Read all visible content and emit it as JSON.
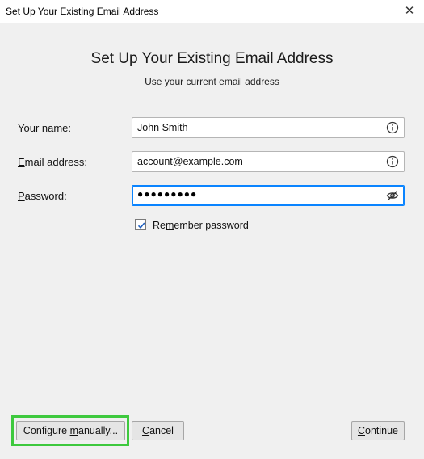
{
  "window": {
    "title": "Set Up Your Existing Email Address",
    "close_icon": "close-icon"
  },
  "header": {
    "title": "Set Up Your Existing Email Address",
    "subtitle": "Use your current email address"
  },
  "form": {
    "name": {
      "label_pre": "Your ",
      "label_key": "n",
      "label_post": "ame:",
      "value": "John Smith",
      "icon": "info-icon"
    },
    "email": {
      "label_pre": "",
      "label_key": "E",
      "label_post": "mail address:",
      "value": "account@example.com",
      "icon": "info-icon"
    },
    "password": {
      "label_pre": "",
      "label_key": "P",
      "label_post": "assword:",
      "masked_value": "●●●●●●●●●",
      "icon": "eye-slash-icon"
    },
    "remember": {
      "label_pre": "Re",
      "label_key": "m",
      "label_post": "ember password",
      "checked": true
    }
  },
  "buttons": {
    "configure": {
      "label_pre": "Configure ",
      "label_key": "m",
      "label_post": "anually..."
    },
    "cancel": {
      "label_pre": "",
      "label_key": "C",
      "label_post": "ancel"
    },
    "continue": {
      "label_pre": "",
      "label_key": "C",
      "label_post": "ontinue"
    }
  },
  "colors": {
    "highlight": "#3ec93e",
    "focus": "#0a84ff",
    "background": "#f0f0f0"
  }
}
